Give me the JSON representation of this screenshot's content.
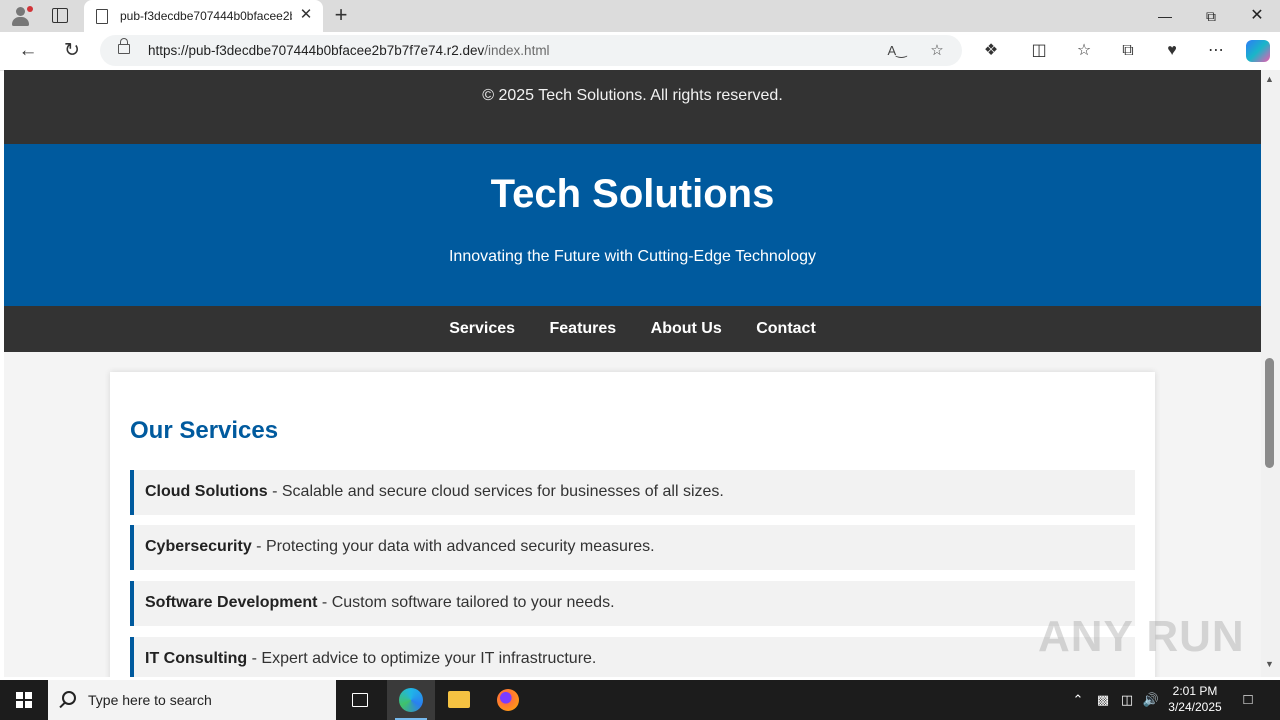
{
  "browser": {
    "tab_title": "pub-f3decdbe707444b0bfacee2b",
    "url_main": "https://pub-f3decdbe707444b0bfacee2b7b7f7e74.r2.dev",
    "url_path": "/index.html",
    "new_tab_glyph": "+",
    "close_tab_glyph": "✕"
  },
  "page": {
    "copyright": "© 2025 Tech Solutions. All rights reserved.",
    "site_title": "Tech Solutions",
    "tagline": "Innovating the Future with Cutting-Edge Technology",
    "nav": [
      "Services",
      "Features",
      "About Us",
      "Contact"
    ],
    "services_heading": "Our Services",
    "services": [
      {
        "name": "Cloud Solutions",
        "desc": " - Scalable and secure cloud services for businesses of all sizes."
      },
      {
        "name": "Cybersecurity",
        "desc": " - Protecting your data with advanced security measures."
      },
      {
        "name": "Software Development",
        "desc": " - Custom software tailored to your needs."
      },
      {
        "name": "IT Consulting",
        "desc": " - Expert advice to optimize your IT infrastructure."
      }
    ]
  },
  "watermark": "ANY RUN",
  "taskbar": {
    "search_placeholder": "Type here to search",
    "time": "2:01 PM",
    "date": "3/24/2025"
  },
  "colors": {
    "brand_blue": "#005a9e",
    "dark_band": "#333333",
    "service_bg": "#f2f2f2"
  }
}
